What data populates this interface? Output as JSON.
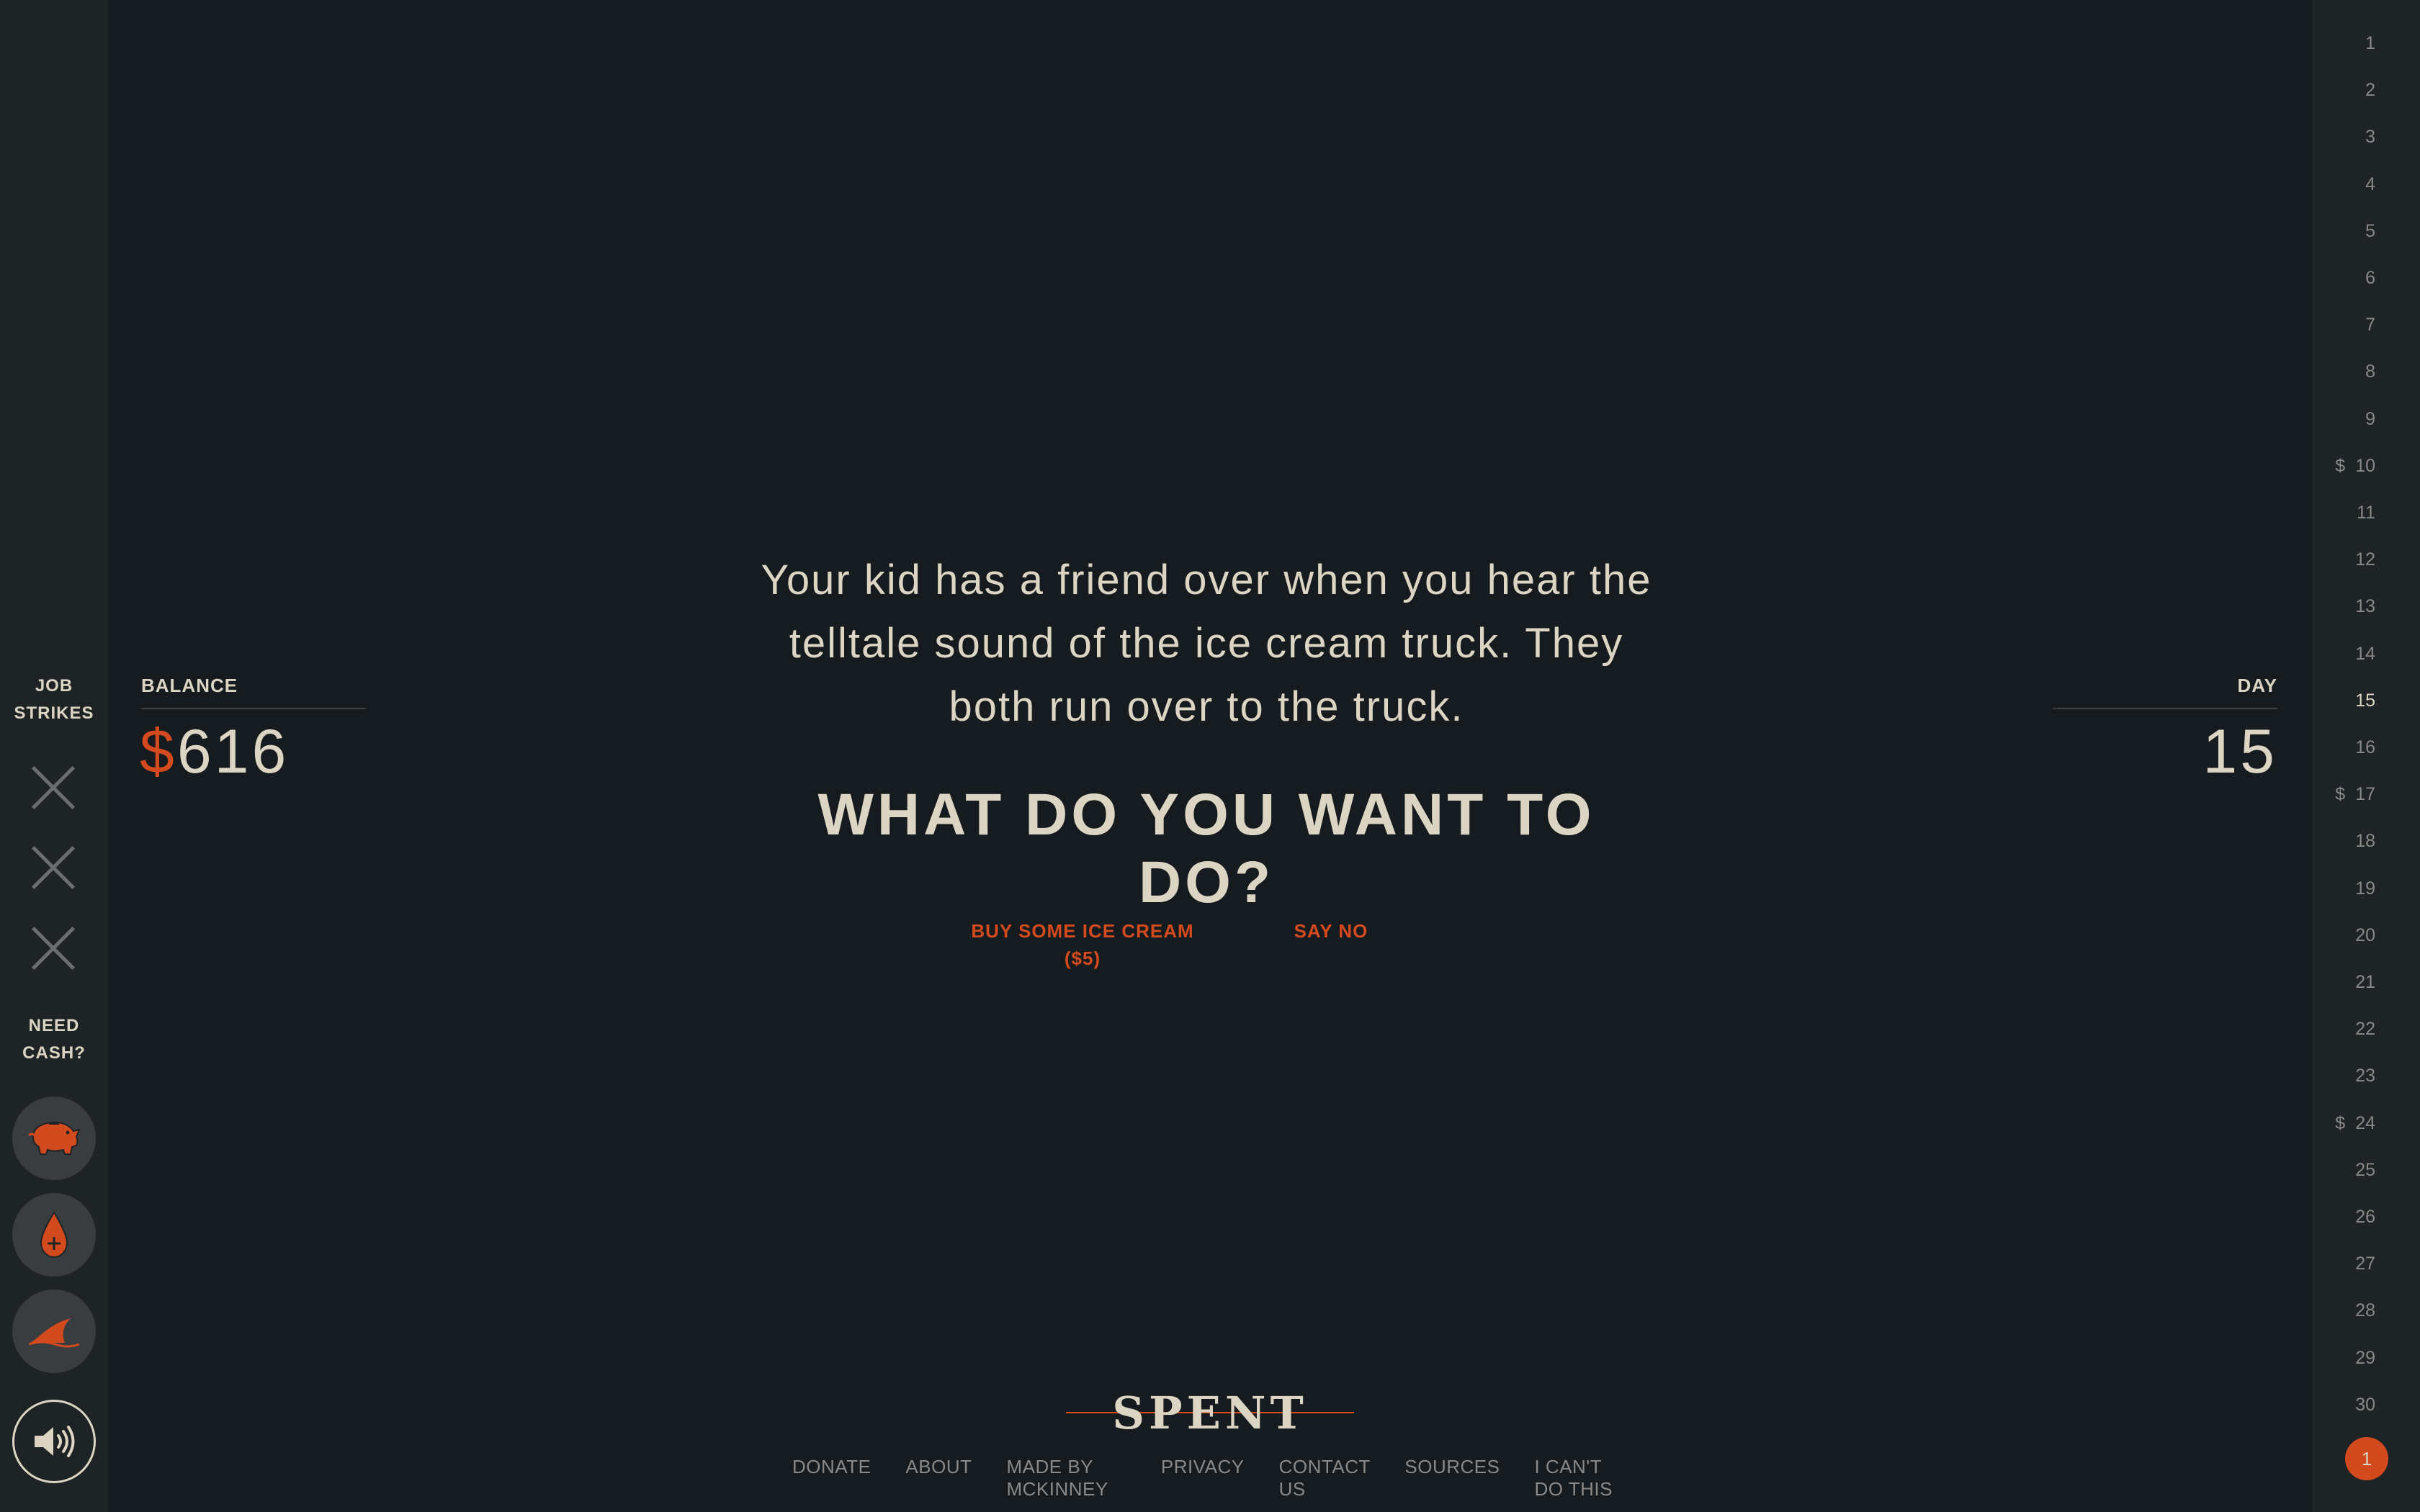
{
  "left_rail": {
    "job_strikes_label_1": "JOB",
    "job_strikes_label_2": "STRIKES",
    "need_cash_label_1": "NEED",
    "need_cash_label_2": "CASH?",
    "cash_options": [
      {
        "icon": "piggy-bank-icon"
      },
      {
        "icon": "blood-drop-icon"
      },
      {
        "icon": "shark-fin-icon"
      }
    ],
    "sound_icon": "speaker-icon"
  },
  "balance": {
    "label": "BALANCE",
    "currency": "$",
    "amount": "616"
  },
  "day": {
    "label": "DAY",
    "value": "15"
  },
  "scenario": {
    "story": "Your kid has a friend over when you hear the telltale sound of the ice cream truck. They both run over to the truck.",
    "question": "WHAT DO YOU WANT TO DO?",
    "choice_a_line1": "BUY SOME ICE CREAM",
    "choice_a_line2": "($5)",
    "choice_b": "SAY NO"
  },
  "footer": {
    "logo_text": "SPENT",
    "links": [
      "DONATE",
      "ABOUT",
      "MADE BY MCKINNEY",
      "PRIVACY",
      "CONTACT US",
      "SOURCES",
      "I CAN'T DO THIS"
    ]
  },
  "day_rail": {
    "days": [
      "1",
      "2",
      "3",
      "4",
      "5",
      "6",
      "7",
      "8",
      "9",
      "10",
      "11",
      "12",
      "13",
      "14",
      "15",
      "16",
      "17",
      "18",
      "19",
      "20",
      "21",
      "22",
      "23",
      "24",
      "25",
      "26",
      "27",
      "28",
      "29",
      "30"
    ],
    "payday_marker": "$",
    "paydays": [
      "10",
      "17",
      "24"
    ],
    "current_day": "15",
    "badge": "1"
  },
  "colors": {
    "accent": "#d24a1e",
    "background": "#161b1f",
    "rail": "#1e2326",
    "text": "#ddd5c3"
  }
}
